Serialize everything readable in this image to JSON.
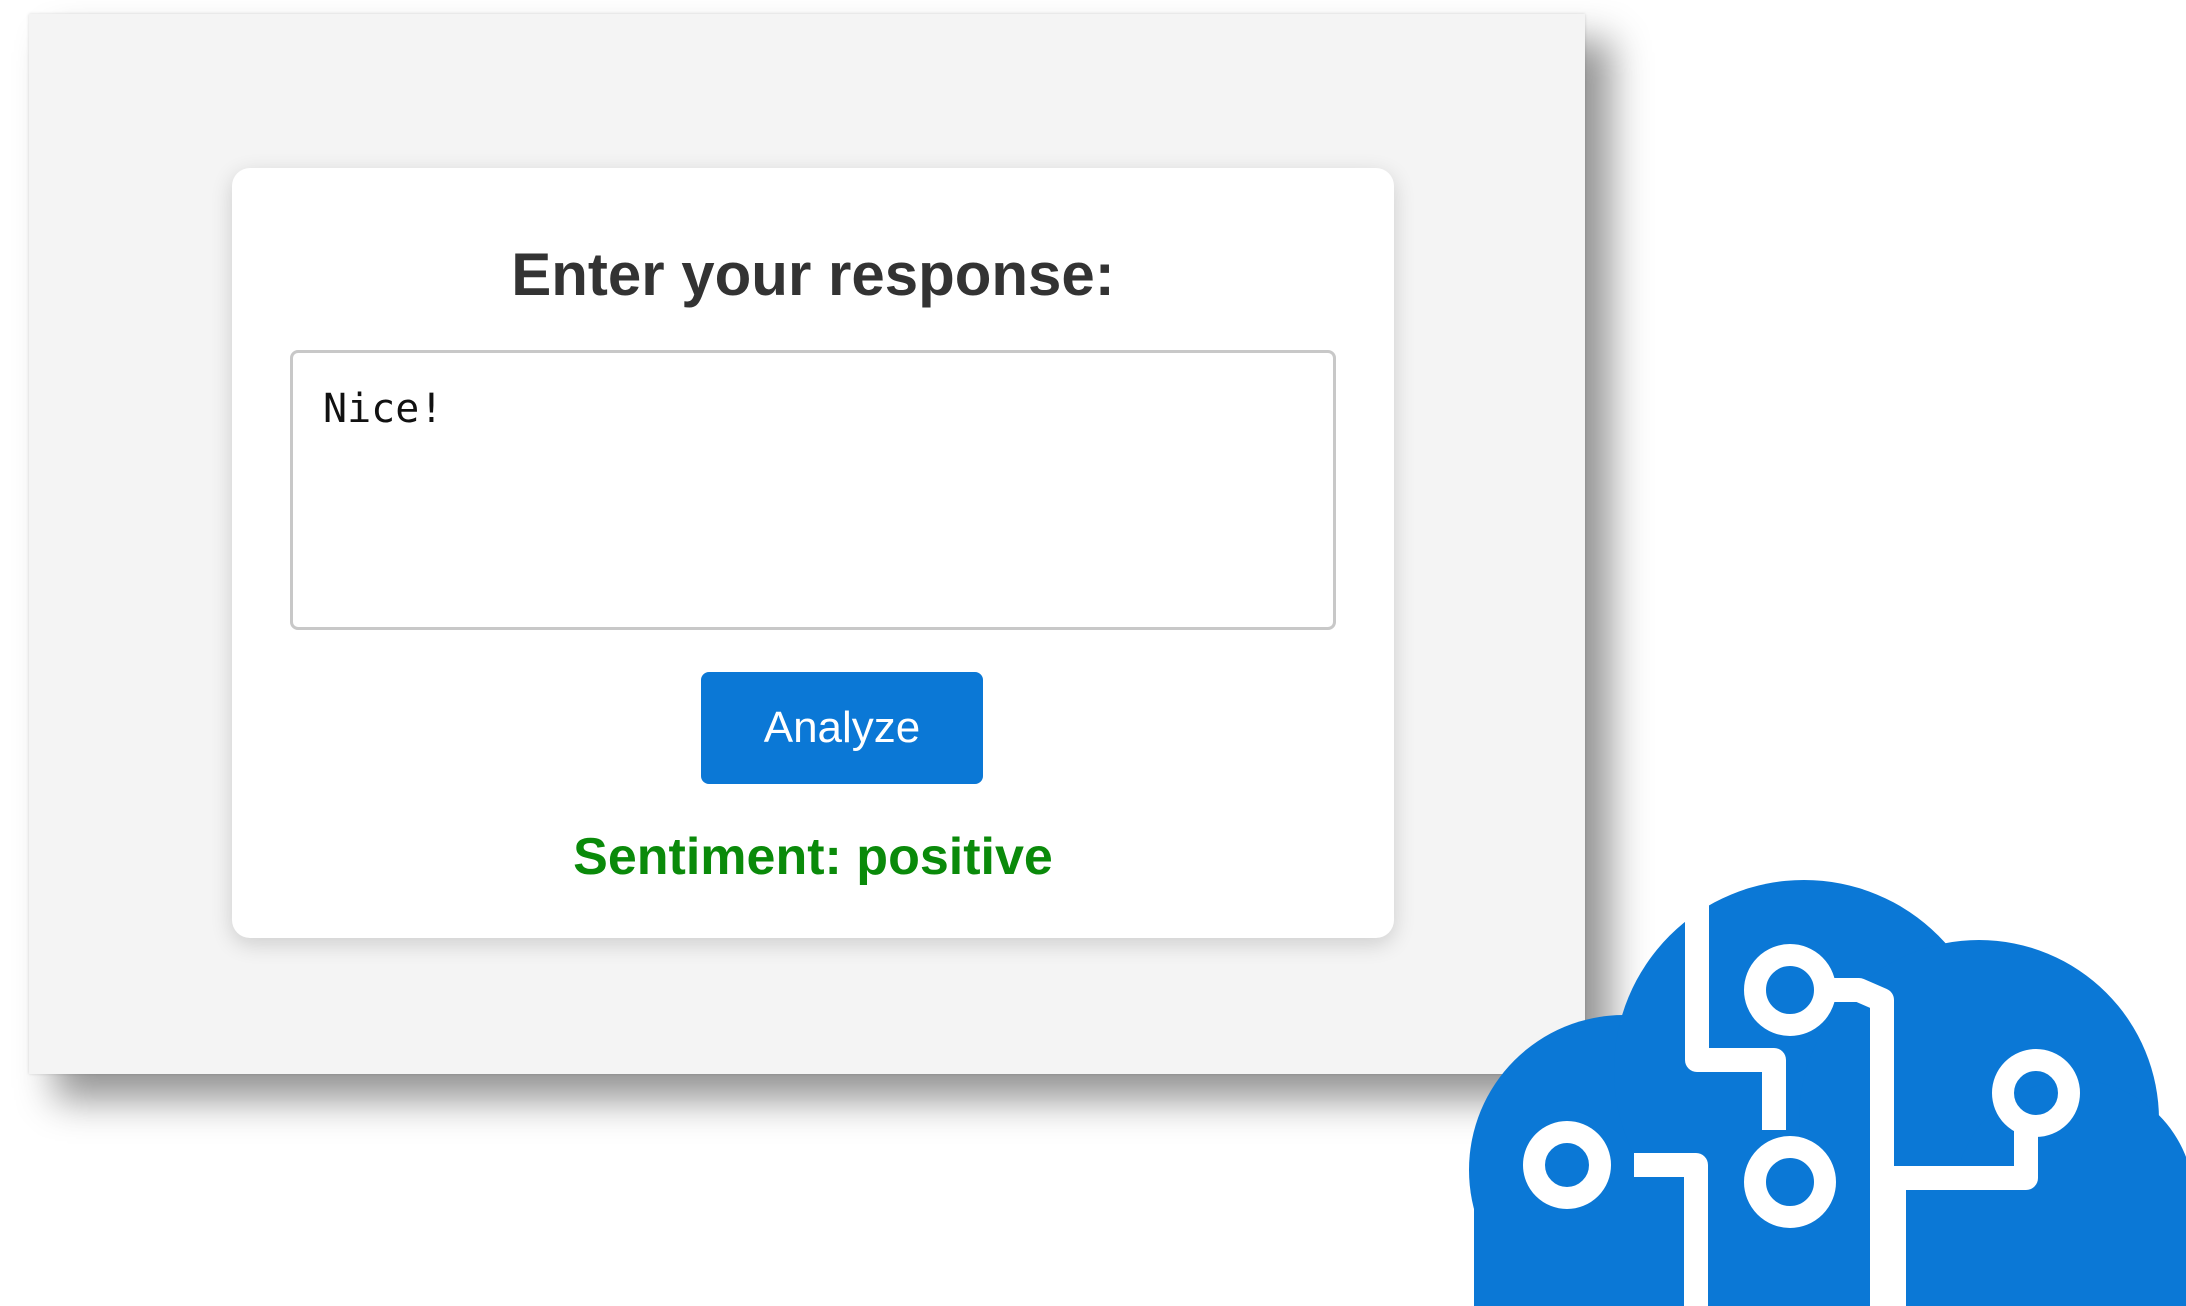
{
  "form": {
    "title": "Enter your response:",
    "response_value": "Nice!",
    "analyze_label": "Analyze"
  },
  "result": {
    "text": "Sentiment: positive",
    "color": "#0a8a0a"
  },
  "logo": {
    "icon": "cloud-brain-circuit-icon",
    "color": "#0b78d6"
  }
}
